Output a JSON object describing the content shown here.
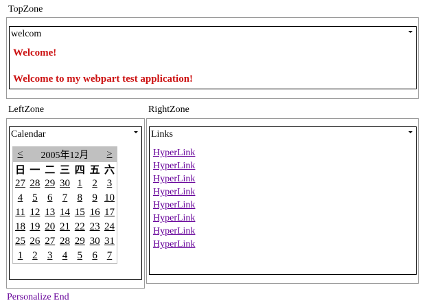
{
  "top_zone": {
    "label": "TopZone",
    "webpart": {
      "title": "welcom",
      "lines": [
        "Welcome!",
        "Welcome to my webpart test application!"
      ]
    }
  },
  "left_zone": {
    "label": "LeftZone",
    "webpart": {
      "title": "Calendar",
      "calendar": {
        "prev": "<",
        "next": ">",
        "month_title": "2005年12月",
        "weekdays": [
          "日",
          "一",
          "二",
          "三",
          "四",
          "五",
          "六"
        ],
        "weeks": [
          [
            "27",
            "28",
            "29",
            "30",
            "1",
            "2",
            "3"
          ],
          [
            "4",
            "5",
            "6",
            "7",
            "8",
            "9",
            "10"
          ],
          [
            "11",
            "12",
            "13",
            "14",
            "15",
            "16",
            "17"
          ],
          [
            "18",
            "19",
            "20",
            "21",
            "22",
            "23",
            "24"
          ],
          [
            "25",
            "26",
            "27",
            "28",
            "29",
            "30",
            "31"
          ],
          [
            "1",
            "2",
            "3",
            "4",
            "5",
            "6",
            "7"
          ]
        ]
      }
    }
  },
  "right_zone": {
    "label": "RightZone",
    "webpart": {
      "title": "Links",
      "links": [
        "HyperLink",
        "HyperLink",
        "HyperLink",
        "HyperLink",
        "HyperLink",
        "HyperLink",
        "HyperLink",
        "HyperLink"
      ]
    }
  },
  "footer": {
    "personalize_label": "Personalize End"
  },
  "colors": {
    "welcome_text": "#cc1111",
    "link_visited": "#660099",
    "calendar_header": "#c0c0c0"
  },
  "icons": {
    "webpart_menu": "dropdown-arrow-icon"
  }
}
